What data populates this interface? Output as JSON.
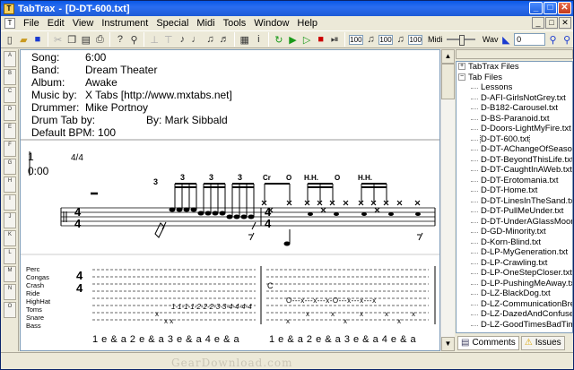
{
  "window": {
    "app_name": "TabTrax",
    "doc_title": "[D-DT-600.txt]",
    "icon_label": "T",
    "min_glyph": "_",
    "max_glyph": "□",
    "close_glyph": "✕"
  },
  "menu": [
    "File",
    "Edit",
    "View",
    "Instrument",
    "Special",
    "Midi",
    "Tools",
    "Window",
    "Help"
  ],
  "toolbar": {
    "tempo1": "100",
    "tempo2": "100",
    "tempo3": "100",
    "midi_label": "Midi",
    "wav_label": "Wav",
    "wav_value": "0"
  },
  "left_tools": [
    "A",
    "B",
    "C",
    "D",
    "E",
    "F",
    "G",
    "H",
    "I",
    "J",
    "K",
    "L",
    "M",
    "N",
    "O",
    "P"
  ],
  "header": {
    "song_label": "Song:",
    "song_value": "6:00",
    "band_label": "Band:",
    "band_value": "Dream Theater",
    "album_label": "Album:",
    "album_value": "Awake",
    "music_label": "Music by:",
    "music_value": "X Tabs [http://www.mxtabs.net]",
    "drummer_label": "Drummer:",
    "drummer_value": "Mike Portnoy",
    "drumtab_label": "Drum Tab by:",
    "drumtab_value": "By: Mark Sibbald",
    "bpm_text": "Default BPM: 100"
  },
  "score": {
    "measure_number": "1",
    "time_position": "0:00",
    "time_sig": "4/4",
    "triplets": [
      "3",
      "3",
      "3",
      "3"
    ],
    "marks": [
      "Cr",
      "O",
      "H.H.",
      "O",
      "H.H."
    ],
    "instruments": [
      "Perc",
      "Congas",
      "Crash",
      "Ride",
      "HighHat",
      "Toms",
      "Snare",
      "Bass"
    ],
    "tab_ts_top": "4",
    "tab_ts_bottom": "4",
    "crash_mark": "C",
    "toms_line": "1-1-1-1-2-2-2-3-3-4-4-4-4",
    "ride_line": "O---x---x---x-O---x---x---x",
    "count1": "1 e & a 2 e & a 3 e & a 4 e & a",
    "count2": "1 e & a 2 e & a 3 e & a 4 e & a"
  },
  "panel": {
    "root1": "TabTrax Files",
    "root2": "Tab Files",
    "files": [
      "Lessons",
      "D-AFI-GirlsNotGrey.txt",
      "D-B182-Carousel.txt",
      "D-BS-Paranoid.txt",
      "D-Doors-LightMyFire.txt",
      "D-DT-600.txt",
      "D-DT-AChangeOfSeasons.txt",
      "D-DT-BeyondThisLife.txt",
      "D-DT-CaughtInAWeb.txt",
      "D-DT-Erotomania.txt",
      "D-DT-Home.txt",
      "D-DT-LinesInTheSand.txt",
      "D-DT-PullMeUnder.txt",
      "D-DT-UnderAGlassMoon.txt",
      "D-GD-Minority.txt",
      "D-Korn-Blind.txt",
      "D-LP-MyGeneration.txt",
      "D-LP-Crawling.txt",
      "D-LP-OneStepCloser.txt",
      "D-LP-PushingMeAway.txt",
      "D-LZ-BlackDog.txt",
      "D-LZ-CommunicationBreakdown.txt",
      "D-LZ-DazedAndConfused.txt",
      "D-LZ-GoodTimesBadTimes.txt"
    ],
    "selected_index": 5,
    "tab_comments": "Comments",
    "tab_issues": "Issues"
  },
  "watermark": "GearDownload.com"
}
